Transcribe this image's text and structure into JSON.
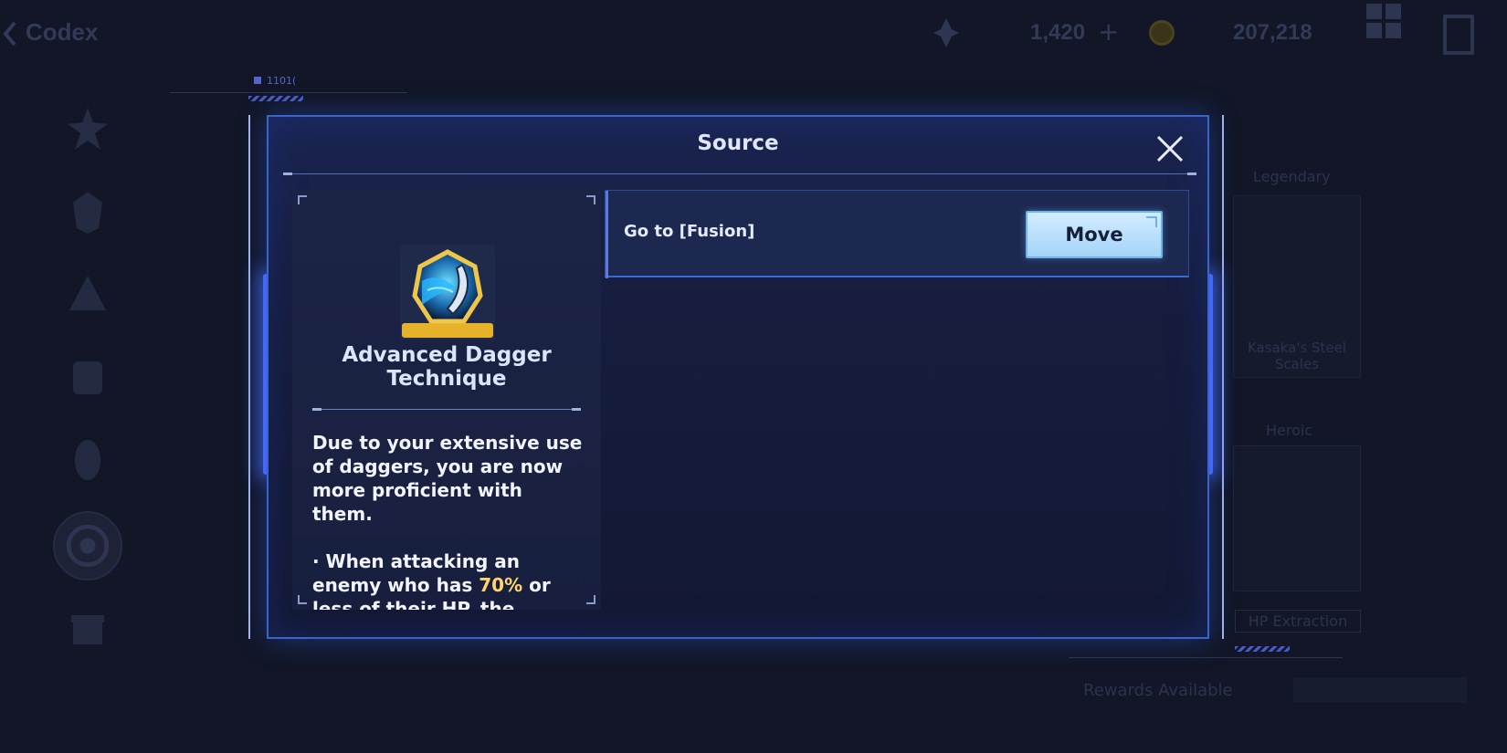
{
  "topbar": {
    "title": "Codex",
    "energy_value": "1,420",
    "energy_plus": "+",
    "coins_value": "207,218"
  },
  "background": {
    "legendary_label": "Legendary",
    "item_name": "Kasaka's Steel Scales",
    "heroic_label": "Heroic",
    "hp_extraction_label": "HP Extraction",
    "rewards_label": "Rewards Available"
  },
  "deco": {
    "tag": "1101("
  },
  "modal": {
    "title": "Source",
    "item": {
      "name": "Advanced Dagger Technique",
      "desc_para1": "Due to your extensive use of daggers, you are now more proficient with them.",
      "desc_bullet_prefix": " · When attacking an enemy who has ",
      "desc_highlight": "70%",
      "desc_bullet_suffix": " or less of their HP, the damage you deal"
    },
    "sources": [
      {
        "label": "Go to [Fusion]",
        "button": "Move"
      }
    ]
  },
  "colors": {
    "accent_blue": "#3a64c8",
    "button_fill": "#a4d4f8",
    "highlight_gold": "#ffd46a",
    "icon_frame_gold": "#e6b22a"
  },
  "icons": [
    "back-arrow-icon",
    "energy-icon",
    "coin-icon",
    "menu-grid-icon",
    "exit-icon",
    "close-icon",
    "dagger-skill-icon"
  ]
}
